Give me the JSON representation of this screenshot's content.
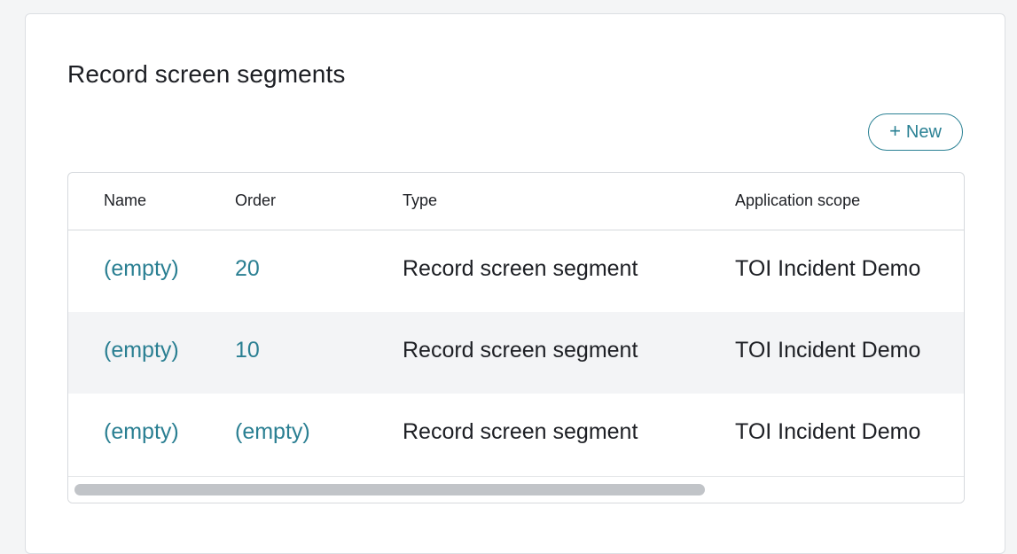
{
  "section": {
    "title": "Record screen segments",
    "new_button_label": "New",
    "new_button_icon": "plus-icon"
  },
  "table": {
    "columns": [
      "Name",
      "Order",
      "Type",
      "Application scope"
    ],
    "rows": [
      {
        "name": "(empty)",
        "order": "20",
        "type": "Record screen segment",
        "scope": "TOI Incident Demo"
      },
      {
        "name": "(empty)",
        "order": "10",
        "type": "Record screen segment",
        "scope": "TOI Incident Demo"
      },
      {
        "name": "(empty)",
        "order": "(empty)",
        "type": "Record screen segment",
        "scope": "TOI Incident Demo"
      }
    ]
  },
  "colors": {
    "link": "#2a7f92",
    "accent": "#2a8194",
    "row_alt": "#f3f4f6"
  }
}
